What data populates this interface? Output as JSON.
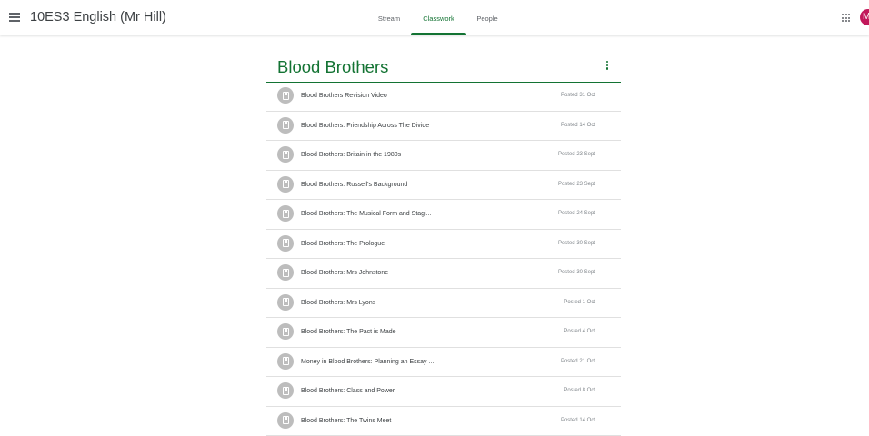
{
  "header": {
    "class_title": "10ES3 English (Mr Hill)",
    "tabs": [
      {
        "label": "Stream",
        "active": false
      },
      {
        "label": "Classwork",
        "active": true
      },
      {
        "label": "People",
        "active": false
      }
    ],
    "avatar_initial": "M",
    "icons": {
      "menu": "hamburger-menu-icon",
      "apps": "google-apps-icon"
    }
  },
  "colors": {
    "accent": "#137333",
    "avatar": "#c2185b",
    "item_icon": "#bdbdbd"
  },
  "topic": {
    "title": "Blood Brothers",
    "items": [
      {
        "title": "Blood Brothers Revision Video",
        "posted": "Posted 31 Oct"
      },
      {
        "title": "Blood Brothers: Friendship Across The Divide",
        "posted": "Posted 14 Oct"
      },
      {
        "title": "Blood Brothers: Britain in the 1980s",
        "posted": "Posted 23 Sept"
      },
      {
        "title": "Blood Brothers: Russell's Background",
        "posted": "Posted 23 Sept"
      },
      {
        "title": "Blood Brothers: The Musical Form and Stagi...",
        "posted": "Posted 24 Sept"
      },
      {
        "title": "Blood Brothers: The Prologue",
        "posted": "Posted 30 Sept"
      },
      {
        "title": "Blood Brothers: Mrs Johnstone",
        "posted": "Posted 30 Sept"
      },
      {
        "title": "Blood Brothers: Mrs Lyons",
        "posted": "Posted 1 Oct"
      },
      {
        "title": "Blood Brothers: The Pact is Made",
        "posted": "Posted 4 Oct"
      },
      {
        "title": "Money in Blood Brothers: Planning an Essay ...",
        "posted": "Posted 21 Oct"
      },
      {
        "title": "Blood Brothers: Class and Power",
        "posted": "Posted 8 Oct"
      },
      {
        "title": "Blood Brothers: The Twins Meet",
        "posted": "Posted 14 Oct"
      }
    ]
  }
}
